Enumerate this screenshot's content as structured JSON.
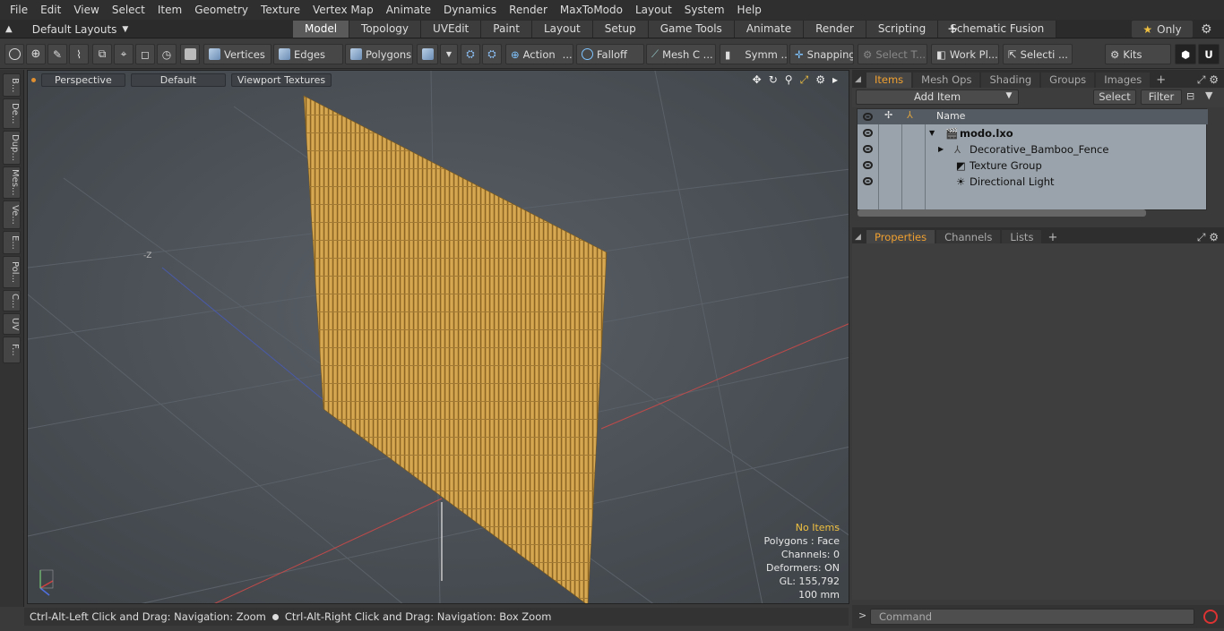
{
  "menubar": {
    "items": [
      "File",
      "Edit",
      "View",
      "Select",
      "Item",
      "Geometry",
      "Texture",
      "Vertex Map",
      "Animate",
      "Dynamics",
      "Render",
      "MaxToModo",
      "Layout",
      "System",
      "Help"
    ]
  },
  "layoutbar": {
    "layout_label": "Default Layouts",
    "tabs": [
      "Model",
      "Topology",
      "UVEdit",
      "Paint",
      "Layout",
      "Setup",
      "Game Tools",
      "Animate",
      "Render",
      "Scripting",
      "Schematic Fusion"
    ],
    "only_label": "Only"
  },
  "toolbar": {
    "vertices": "Vertices",
    "edges": "Edges",
    "polygons": "Polygons",
    "action": "Action",
    "falloff": "Falloff",
    "meshc": "Mesh C ...",
    "symm": "Symm ...",
    "snapping": "Snapping",
    "selectt": "Select T...",
    "workpl": "Work Pl...",
    "selecti": "Selecti ...",
    "kits": "Kits"
  },
  "lefttabs": [
    "B...",
    "De...",
    "Dup...",
    "Mes...",
    "Ve...",
    "E...",
    "Pol...",
    "C...",
    "UV",
    "F..."
  ],
  "viewport": {
    "view_mode": "Perspective",
    "shading": "Default",
    "textures": "Viewport Textures",
    "axis_label": "-Z",
    "info": {
      "selection": "No Items",
      "polygons": "Polygons : Face",
      "channels": "Channels: 0",
      "deformers": "Deformers: ON",
      "gl": "GL: 155,792",
      "units": "100 mm"
    }
  },
  "statusbar": {
    "left": "Ctrl-Alt-Left Click and Drag: Navigation: Zoom",
    "right": "Ctrl-Alt-Right Click and Drag: Navigation: Box Zoom"
  },
  "items_panel": {
    "tabs": [
      "Items",
      "Mesh Ops",
      "Shading",
      "Groups",
      "Images"
    ],
    "add_item": "Add Item",
    "select": "Select",
    "filter": "Filter",
    "name_header": "Name",
    "rows": [
      "modo.lxo",
      "Decorative_Bamboo_Fence",
      "Texture Group",
      "Directional Light"
    ]
  },
  "props_panel": {
    "tabs": [
      "Properties",
      "Channels",
      "Lists"
    ]
  },
  "command": {
    "placeholder": "Command",
    "prompt": ">"
  },
  "colors": {
    "accent": "#f0a030",
    "bamboo": "#c99a44",
    "viewport_bg": "#4a4f55"
  }
}
